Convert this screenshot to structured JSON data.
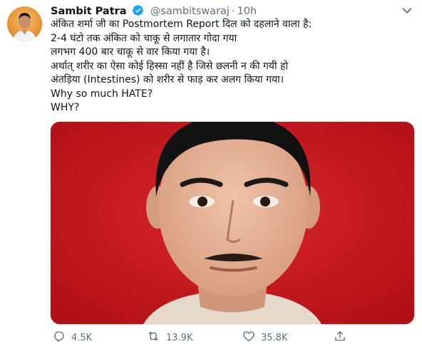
{
  "author": {
    "name": "Sambit Patra",
    "handle": "@sambitswaraj",
    "separator": "·",
    "time": "10h",
    "avatar_icon": "profile-photo",
    "verified_icon": "verified-badge-icon"
  },
  "tweet_text": [
    "अंकित शर्मा जी का Postmortem Report दिल को दहलाने वाला है:",
    "2-4 घंटो तक अंकित को चाकू से लगातार गोदा गया",
    "लगभग 400 बार चाकू से वार किया गया है।",
    "अर्थात् शरीर का ऐसा कोई हिस्सा नहीं है जिसे छलनी न की गयी हो",
    "अंतड़िया (Intestines) को शरीर से फाड़ कर अलग किया गया।",
    "Why so much HATE?",
    "WHY?"
  ],
  "actions": {
    "reply_count": "4.5K",
    "retweet_count": "13.9K",
    "like_count": "35.8K"
  },
  "colors": {
    "text": "#0f1419",
    "secondary": "#5b7083",
    "verified": "#1da1f2",
    "photo_background": "#c4161b"
  }
}
